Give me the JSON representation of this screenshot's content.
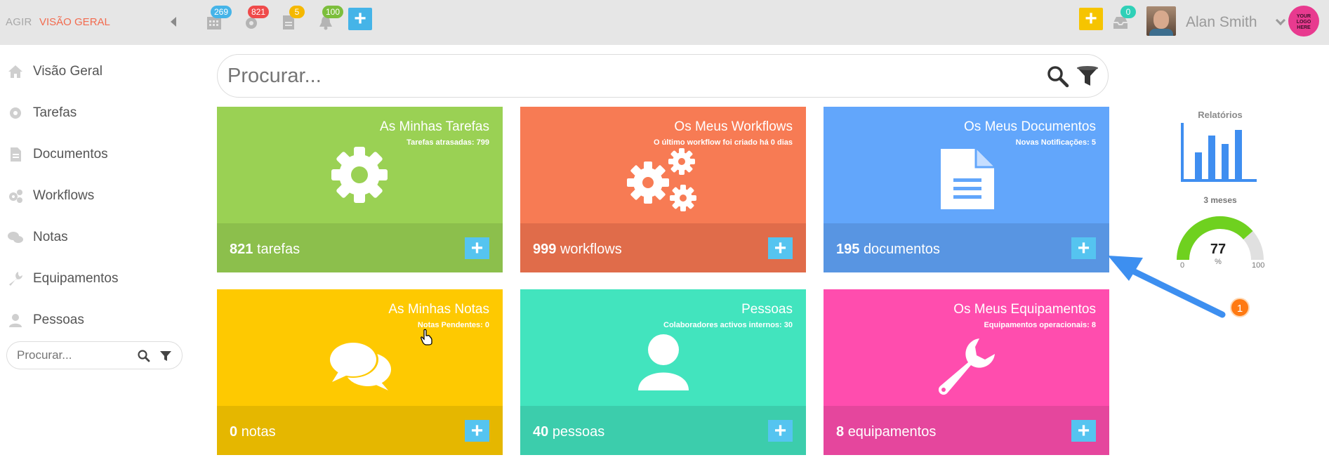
{
  "header": {
    "brand": "AGIR",
    "page": "VISÃO GERAL",
    "counters": [
      {
        "icon": "calendar-icon",
        "value": "269",
        "color": "#45b4e8"
      },
      {
        "icon": "gear-icon",
        "value": "821",
        "color": "#ef4a4a"
      },
      {
        "icon": "document-icon",
        "value": "5",
        "color": "#f5b800"
      },
      {
        "icon": "bell-icon",
        "value": "100",
        "color": "#7cbe3c"
      }
    ],
    "add_label": "+",
    "quick_add_label": "+",
    "inbox_count": "0",
    "user_name": "Alan Smith",
    "logo_text": [
      "YOUR",
      "LOGO",
      "HERE"
    ]
  },
  "sidebar": {
    "items": [
      {
        "label": "Visão Geral",
        "icon": "home-icon"
      },
      {
        "label": "Tarefas",
        "icon": "gear-icon"
      },
      {
        "label": "Documentos",
        "icon": "document-icon"
      },
      {
        "label": "Workflows",
        "icon": "gears-icon"
      },
      {
        "label": "Notas",
        "icon": "chat-icon"
      },
      {
        "label": "Equipamentos",
        "icon": "wrench-icon"
      },
      {
        "label": "Pessoas",
        "icon": "person-icon"
      }
    ],
    "search_placeholder": "Procurar..."
  },
  "search": {
    "placeholder": "Procurar..."
  },
  "tiles": [
    {
      "title": "As Minhas Tarefas",
      "subtitle": "Tarefas atrasadas: 799",
      "count": "821",
      "unit": "tarefas",
      "color": "#9ad154",
      "footer_color": "#8cbf4c",
      "icon": "gear-icon"
    },
    {
      "title": "Os Meus Workflows",
      "subtitle": "O último workflow foi criado há 0 dias",
      "count": "999",
      "unit": "workflows",
      "color": "#f77b54",
      "footer_color": "#e06c4a",
      "icon": "gears-icon"
    },
    {
      "title": "Os Meus Documentos",
      "subtitle": "Novas Notificações: 5",
      "count": "195",
      "unit": "documentos",
      "color": "#62a6fb",
      "footer_color": "#5895e2",
      "icon": "document-icon"
    },
    {
      "title": "As Minhas Notas",
      "subtitle": "Notas Pendentes: 0",
      "count": "0",
      "unit": "notas",
      "color": "#fec901",
      "footer_color": "#e5b700",
      "icon": "chat-icon"
    },
    {
      "title": "Pessoas",
      "subtitle": "Colaboradores activos internos: 30",
      "count": "40",
      "unit": "pessoas",
      "color": "#42e4be",
      "footer_color": "#3ccdac",
      "icon": "person-icon"
    },
    {
      "title": "Os Meus Equipamentos",
      "subtitle": "Equipamentos operacionais: 8",
      "count": "8",
      "unit": "equipamentos",
      "color": "#ff4dae",
      "footer_color": "#e5469d",
      "icon": "wrench-icon"
    }
  ],
  "tile_add_label": "+",
  "widgets": {
    "reports_title": "Relatórios",
    "gauge_period": "3 meses",
    "gauge_value": "77",
    "gauge_unit": "%",
    "gauge_min": "0",
    "gauge_max": "100",
    "gauge_fraction": 0.77
  },
  "annotation": {
    "step": "1"
  }
}
